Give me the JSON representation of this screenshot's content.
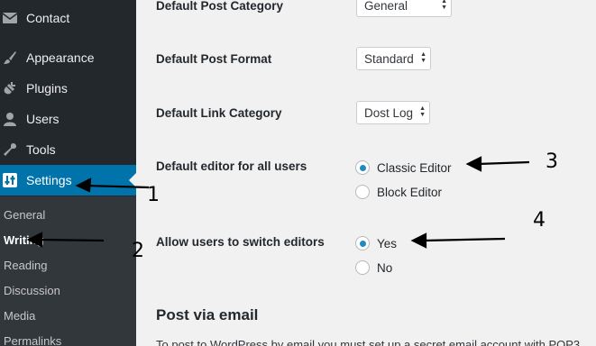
{
  "sidebar": {
    "items": [
      {
        "label": "Contact",
        "icon": "mail-icon"
      },
      {
        "label": "Appearance",
        "icon": "paintbrush-icon"
      },
      {
        "label": "Plugins",
        "icon": "plug-icon"
      },
      {
        "label": "Users",
        "icon": "user-icon"
      },
      {
        "label": "Tools",
        "icon": "wrench-icon"
      },
      {
        "label": "Settings",
        "icon": "settings-sliders-icon",
        "active": true
      }
    ],
    "submenu": [
      "General",
      "Writing",
      "Reading",
      "Discussion",
      "Media",
      "Permalinks"
    ],
    "current_submenu": "Writing"
  },
  "fields": {
    "post_category": {
      "label": "Default Post Category",
      "value": "General"
    },
    "post_format": {
      "label": "Default Post Format",
      "value": "Standard"
    },
    "link_category": {
      "label": "Default Link Category",
      "value": "Dost Log"
    },
    "editor": {
      "label": "Default editor for all users",
      "options": [
        "Classic Editor",
        "Block Editor"
      ],
      "selected": "Classic Editor"
    },
    "switch": {
      "label": "Allow users to switch editors",
      "options": [
        "Yes",
        "No"
      ],
      "selected": "Yes"
    }
  },
  "post_via_email": {
    "title": "Post via email",
    "text": "To post to WordPress by email you must set up a secret email account with POP3"
  },
  "annotations": [
    "1",
    "2",
    "3",
    "4"
  ],
  "colors": {
    "sidebar": "#23282d",
    "submenu": "#32373c",
    "accent": "#0073aa",
    "background": "#f1f1f1"
  }
}
